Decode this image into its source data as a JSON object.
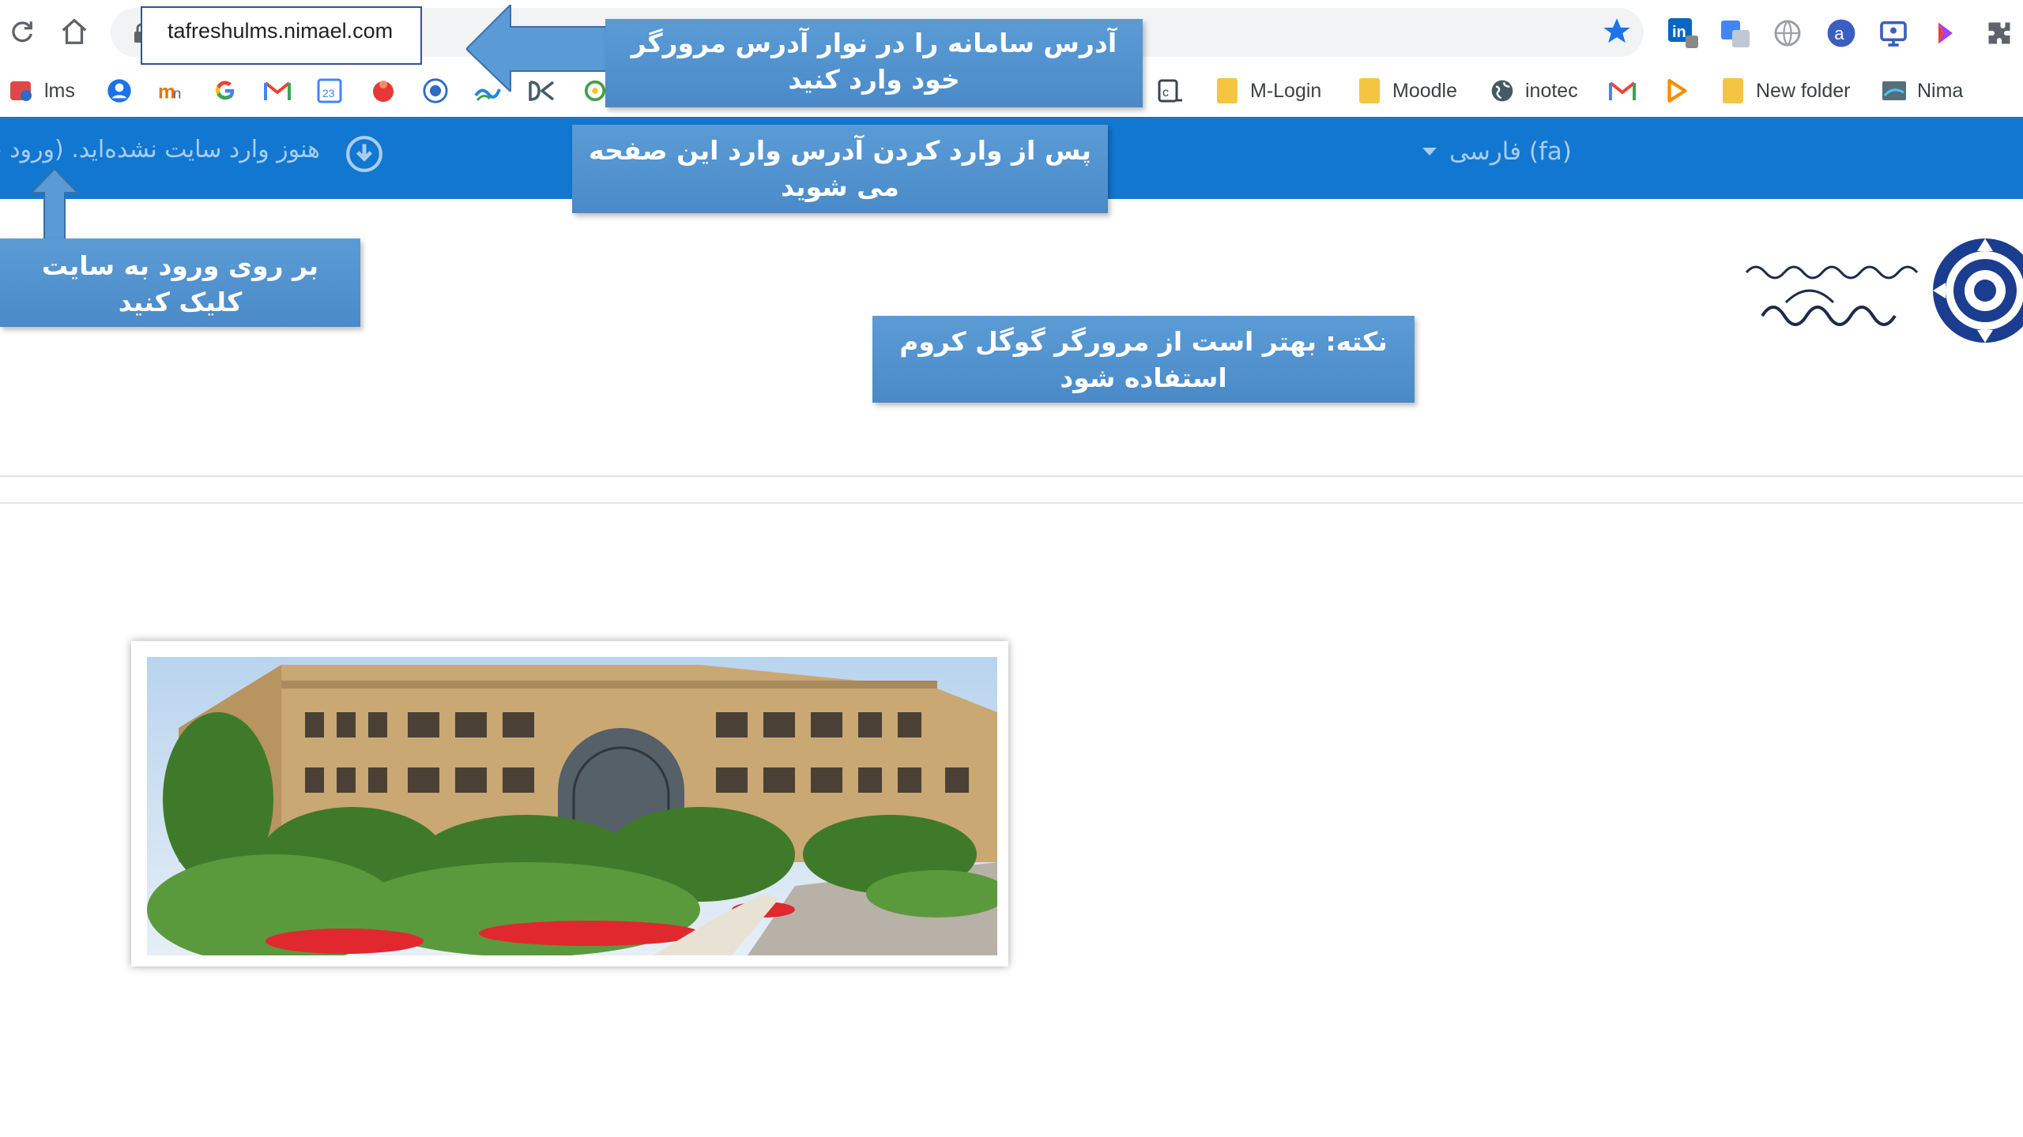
{
  "browser": {
    "url": "tafreshulms.nimael.com",
    "bookmarks": [
      {
        "label": "lms",
        "icon": "lms-icon"
      },
      {
        "label": "",
        "icon": "account-icon"
      },
      {
        "label": "",
        "icon": "mn-icon"
      },
      {
        "label": "",
        "icon": "google-icon"
      },
      {
        "label": "",
        "icon": "gmail-icon"
      },
      {
        "label": "",
        "icon": "calendar-icon"
      },
      {
        "label": "",
        "icon": "red-app-icon"
      },
      {
        "label": "",
        "icon": "university-icon"
      },
      {
        "label": "",
        "icon": "wave-icon"
      },
      {
        "label": "",
        "icon": "dk-icon"
      },
      {
        "label": "",
        "icon": "green-app-icon"
      },
      {
        "label": "",
        "icon": "c-app-icon"
      },
      {
        "label": "M-Login",
        "icon": "folder-icon"
      },
      {
        "label": "Moodle",
        "icon": "folder-icon"
      },
      {
        "label": "inotec",
        "icon": "globe-icon"
      },
      {
        "label": "",
        "icon": "gmail-icon"
      },
      {
        "label": "",
        "icon": "play-icon"
      },
      {
        "label": "New folder",
        "icon": "folder-icon"
      },
      {
        "label": "Nima",
        "icon": "nima-icon"
      }
    ],
    "colors": {
      "accent": "#1a73e8",
      "star": "#1a73e8"
    }
  },
  "navbar": {
    "not_logged_in_text": "هنوز وارد سایت نشده‌اید. (ورود ب",
    "language_label": "فارسی (fa)",
    "background_color": "#1177d1"
  },
  "callouts": {
    "address_hint": "آدرس سامانه را در نوار آدرس مرورگر خود وارد کنید",
    "page_hint": "پس از وارد کردن آدرس وارد این صفحه می شوید",
    "login_hint": "بر روی ورود به سایت کلیک کنید",
    "browser_note": "نکته: بهتر است از مرورگر گوگل کروم استفاده شود",
    "color": "#5b9bd5"
  },
  "logo": {
    "line1": "وزارت علوم، تحقیقات و فناوری",
    "line2": "دانشگاه تفرش"
  }
}
